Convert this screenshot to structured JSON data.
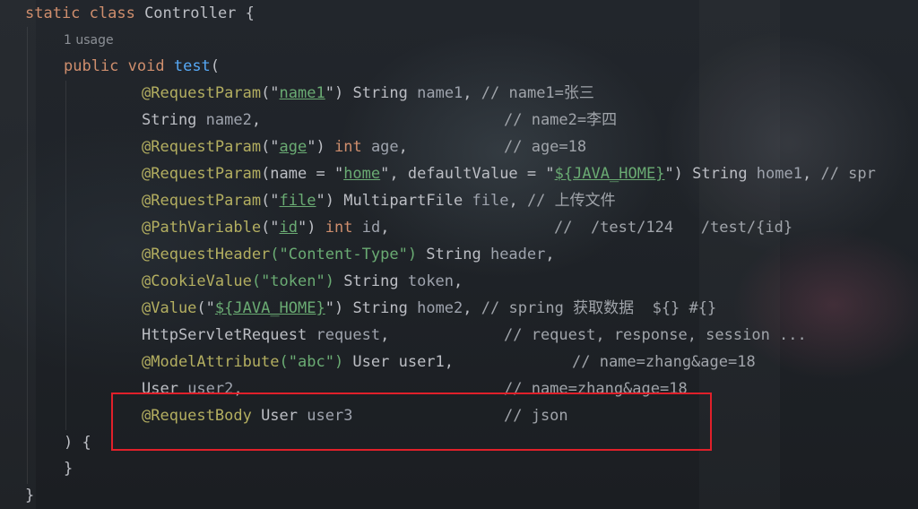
{
  "editor": {
    "usage_hint": "1 usage",
    "lines": {
      "class_decl": {
        "kw": "static class ",
        "name": "Controller {"
      },
      "method_decl": {
        "kw1": "public ",
        "kw2": "void ",
        "fn": "test",
        "rest": "("
      },
      "p1": {
        "ann": "@RequestParam",
        "a": "(\"",
        "s": "name1",
        "b": "\") ",
        "type": "String ",
        "param": "name1",
        "c": ", ",
        "comment": "// name1=张三"
      },
      "p2": {
        "type": "String ",
        "param": "name2",
        "c": ",",
        "comment": "// name2=李四"
      },
      "p3": {
        "ann": "@RequestParam",
        "a": "(\"",
        "s": "age",
        "b": "\") ",
        "kw": "int ",
        "param": "age",
        "c": ",",
        "comment": "// age=18"
      },
      "p4": {
        "ann": "@RequestParam",
        "a": "(name = \"",
        "s": "home",
        "b": "\", defaultValue = \"",
        "s2": "${JAVA_HOME}",
        "c": "\") String ",
        "param": "home1",
        "d": ", ",
        "comment": "// spr"
      },
      "p5": {
        "ann": "@RequestParam",
        "a": "(\"",
        "s": "file",
        "b": "\") MultipartFile ",
        "param": "file",
        "c": ", ",
        "comment": "// 上传文件"
      },
      "p6": {
        "ann": "@PathVariable",
        "a": "(\"",
        "s": "id",
        "b": "\") ",
        "kw": "int ",
        "param": "id",
        "c": ",",
        "comment": "//  /test/124   /test/{id}"
      },
      "p7": {
        "ann": "@RequestHeader",
        "s": "(\"Content-Type\")",
        "b": " String ",
        "param": "header",
        "c": ","
      },
      "p8": {
        "ann": "@CookieValue",
        "s": "(\"token\")",
        "b": " String ",
        "param": "token",
        "c": ","
      },
      "p9": {
        "ann": "@Value",
        "a": "(\"",
        "s": "${JAVA_HOME}",
        "b": "\") String ",
        "param": "home2",
        "c": ", ",
        "comment": "// spring 获取数据  ${} #{}"
      },
      "p10": {
        "type": "HttpServletRequest ",
        "param": "request",
        "c": ",",
        "comment": "// request, response, session ..."
      },
      "p11": {
        "ann": "@ModelAttribute",
        "s": "(\"abc\")",
        "b": " User user1,",
        "comment": "// name=zhang&age=18"
      },
      "p12": {
        "type": "User ",
        "param": "user2",
        "c": ",",
        "comment": "// name=zhang&age=18"
      },
      "p13": {
        "ann": "@RequestBody",
        "b": " User ",
        "param": "user3",
        "comment": "// json"
      },
      "close_paren": ") {",
      "close_brace_inner": "}",
      "close_brace_outer": "}"
    }
  },
  "colors": {
    "keyword": "#cf8e6d",
    "function": "#56a8f5",
    "annotation": "#b3ae60",
    "string": "#6aab73",
    "text": "#bcbec4",
    "highlight_border": "#e0202a"
  }
}
